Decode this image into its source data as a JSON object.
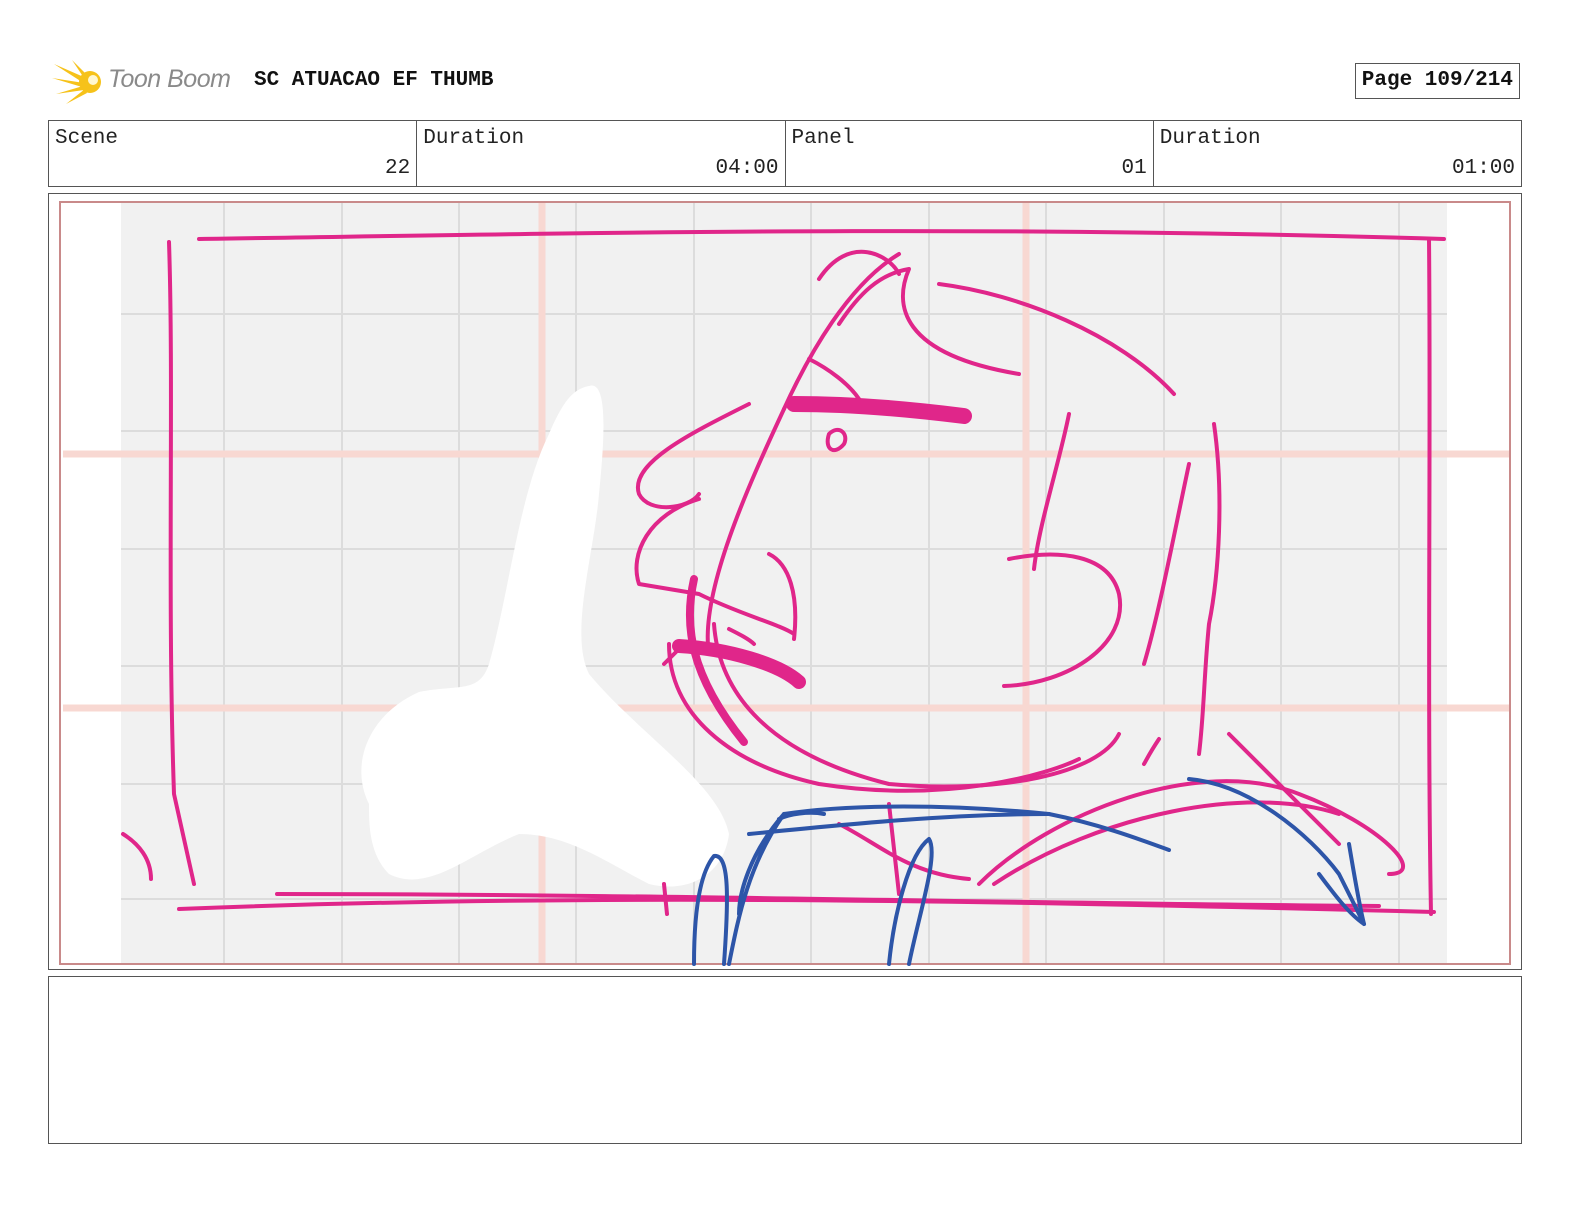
{
  "header": {
    "logo_text": "Toon Boom",
    "title": "SC ATUACAO EF THUMB",
    "page_label": "Page 109/214"
  },
  "info": {
    "scene_label": "Scene",
    "scene_value": "22",
    "scene_duration_label": "Duration",
    "scene_duration_value": "04:00",
    "panel_label": "Panel",
    "panel_value": "01",
    "panel_duration_label": "Duration",
    "panel_duration_value": "01:00"
  },
  "notes": {
    "text": ""
  },
  "colors": {
    "sketch_pink": "#e0268a",
    "sketch_blue": "#2d55a8",
    "grid_bg": "#f1f1f1",
    "safe_frame": "#c98a8a",
    "logo_yellow": "#f6c21a"
  },
  "icons": {
    "logo": "toon-boom-star-icon"
  }
}
